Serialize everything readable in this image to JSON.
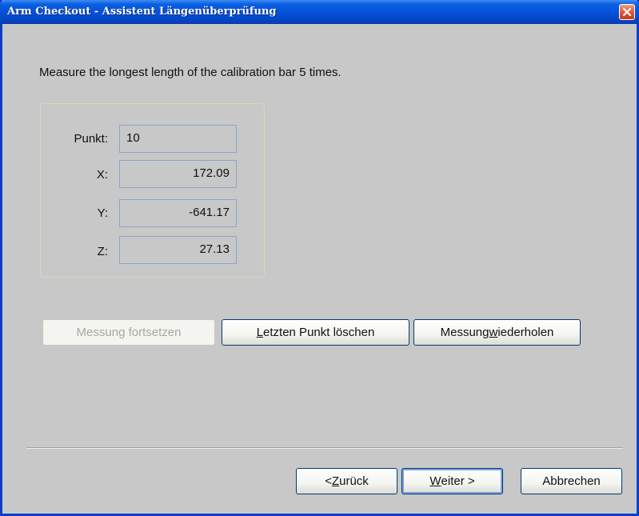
{
  "window": {
    "title": "Arm Checkout - Assistent Längenüberprüfung"
  },
  "instruction": "Measure the longest length of the calibration bar 5 times.",
  "fields": {
    "punkt": {
      "label": "Punkt:",
      "value": "10"
    },
    "x": {
      "label": "X:",
      "value": "172.09"
    },
    "y": {
      "label": "Y:",
      "value": "-641.17"
    },
    "z": {
      "label": "Z:",
      "value": "27.13"
    }
  },
  "actions": {
    "continue_measurement": {
      "label": "Messung fortsetzen",
      "enabled": false
    },
    "delete_last_point": {
      "pre": "",
      "mnemonic": "L",
      "post": "etzten Punkt löschen"
    },
    "repeat_measurement": {
      "pre": "Messung ",
      "mnemonic": "w",
      "post": "iederholen"
    }
  },
  "nav": {
    "back": {
      "pre": "< ",
      "mnemonic": "Z",
      "post": "urück"
    },
    "next": {
      "pre": "",
      "mnemonic": "W",
      "post": "eiter >"
    },
    "cancel": {
      "label": "Abbrechen"
    }
  },
  "colors": {
    "titlebar": "#0550d8",
    "dialog_bg": "#c8c8c8",
    "close_button": "#e06040",
    "field_border": "#8aa4c8"
  }
}
